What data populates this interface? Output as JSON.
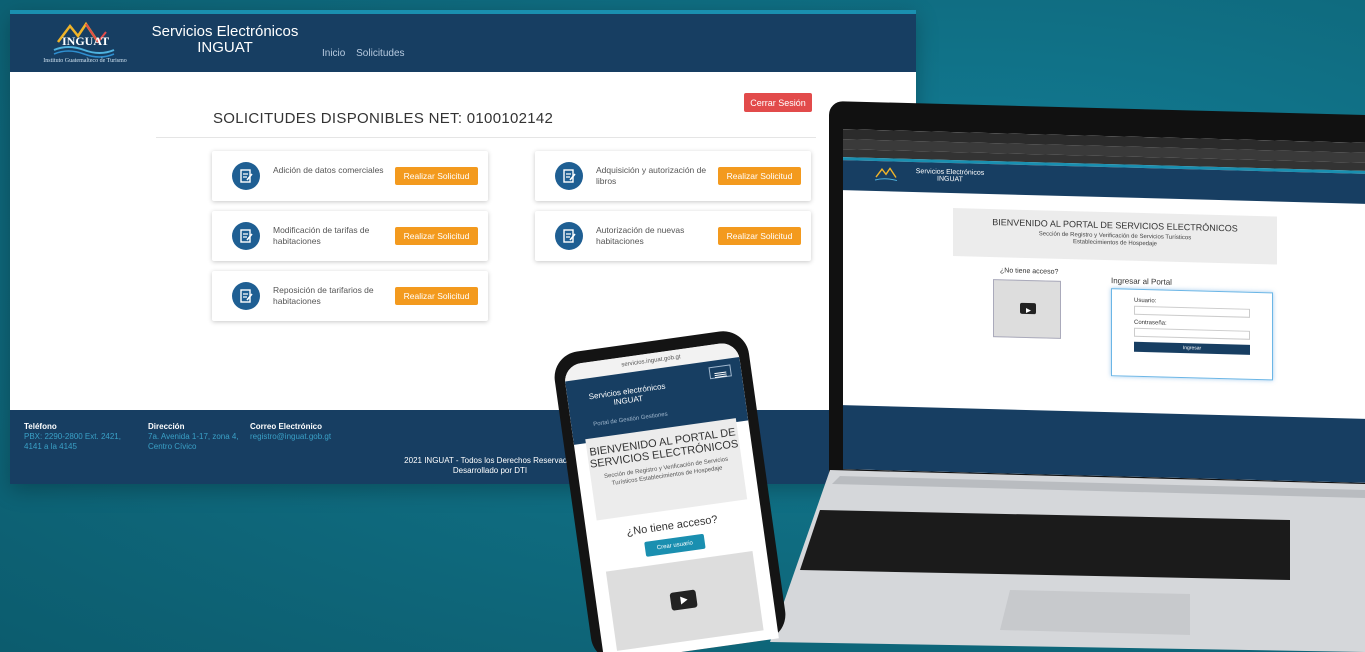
{
  "header": {
    "logo_text": "INGUAT",
    "logo_sub": "Instituto Guatemalteco de Turismo",
    "title_line1": "Servicios Electrónicos",
    "title_line2": "INGUAT",
    "nav": [
      "Inicio",
      "Solicitudes"
    ]
  },
  "main": {
    "logout_label": "Cerrar Sesión",
    "page_title": "SOLICITUDES DISPONIBLES NET: 0100102142",
    "cards": [
      {
        "label": "Adición de datos comerciales",
        "button": "Realizar Solicitud"
      },
      {
        "label": "Adquisición y autorización de libros",
        "button": "Realizar Solicitud"
      },
      {
        "label": "Modificación de tarifas de habitaciones",
        "button": "Realizar Solicitud"
      },
      {
        "label": "Autorización de nuevas habitaciones",
        "button": "Realizar Solicitud"
      },
      {
        "label": "Reposición de tarifarios de habitaciones",
        "button": "Realizar Solicitud"
      }
    ]
  },
  "footer": {
    "phone_label": "Teléfono",
    "phone_value": "PBX: 2290-2800 Ext. 2421, 4141 a la 4145",
    "address_label": "Dirección",
    "address_value": "7a. Avenida 1-17, zona 4, Centro Cívico",
    "email_label": "Correo Electrónico",
    "email_value": "registro@inguat.gob.gt",
    "copyright": "2021 INGUAT - Todos los Derechos Reservados",
    "developed": "Desarrollado por DTI"
  },
  "laptop": {
    "title_line1": "Servicios Electrónicos",
    "title_line2": "INGUAT",
    "welcome": "BIENVENIDO AL PORTAL DE SERVICIOS ELECTRÓNICOS",
    "welcome_sub1": "Sección de Registro y Verificación de Servicios Turísticos",
    "welcome_sub2": "Establecimientos de Hospedaje",
    "no_access": "¿No tiene acceso?",
    "login_title": "Ingresar al Portal",
    "user_label": "Usuario:",
    "password_label": "Contraseña:",
    "login_button": "Ingresar"
  },
  "phone": {
    "url": "servicios.inguat.gob.gt",
    "title_line1": "Servicios electrónicos",
    "title_line2": "INGUAT",
    "nav": "Portal de Gestión   Gestiones",
    "welcome": "BIENVENIDO AL PORTAL DE SERVICIOS ELECTRÓNICOS",
    "welcome_sub": "Sección de Registro y Verificación de Servicios Turísticos Establecimientos de Hospedaje",
    "no_access": "¿No tiene acceso?",
    "create_user": "Crear usuario"
  },
  "colors": {
    "background": "#0f6b7f",
    "header": "#173e62",
    "accent_orange": "#f39a1e",
    "logout_red": "#e24b4b",
    "link_blue": "#3aa0c6"
  }
}
